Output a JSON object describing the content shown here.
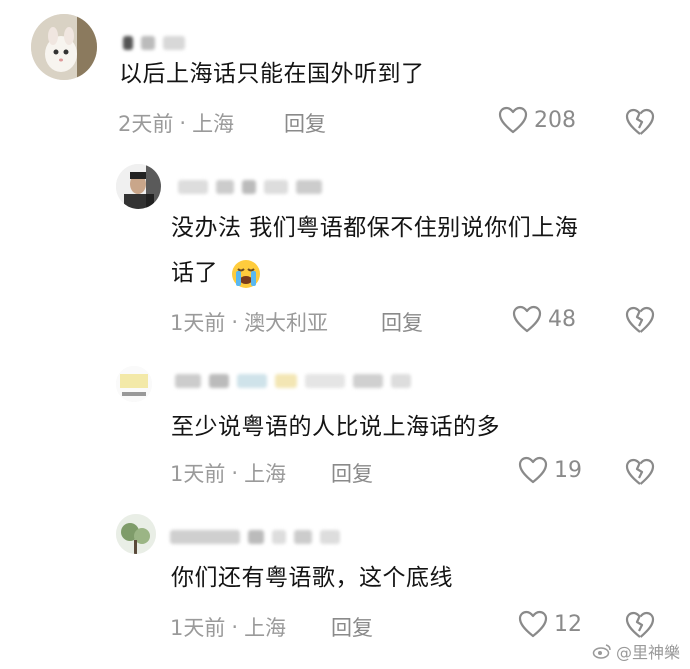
{
  "comments": [
    {
      "text": "以后上海话只能在国外听到了",
      "time": "2天前",
      "location": "上海",
      "reply": "回复",
      "likes": "208"
    },
    {
      "text_line1": "没办法 我们粤语都保不住别说你们上海",
      "text_line2": "话了",
      "time": "1天前",
      "location": "澳大利亚",
      "reply": "回复",
      "likes": "48"
    },
    {
      "text": "至少说粤语的人比说上海话的多",
      "time": "1天前",
      "location": "上海",
      "reply": "回复",
      "likes": "19"
    },
    {
      "text": "你们还有粤语歌，这个底线",
      "time": "1天前",
      "location": "上海",
      "reply": "回复",
      "likes": "12"
    }
  ],
  "separator": "·",
  "watermark": "@里神樂",
  "icons": {
    "like": "heart-outline-icon",
    "dislike": "broken-heart-icon",
    "emoji": "loudly-crying-face-emoji",
    "weibo": "weibo-logo-icon"
  },
  "colors": {
    "text": "#141414",
    "meta": "#9a9a9a",
    "icon": "#8a8a8a"
  }
}
